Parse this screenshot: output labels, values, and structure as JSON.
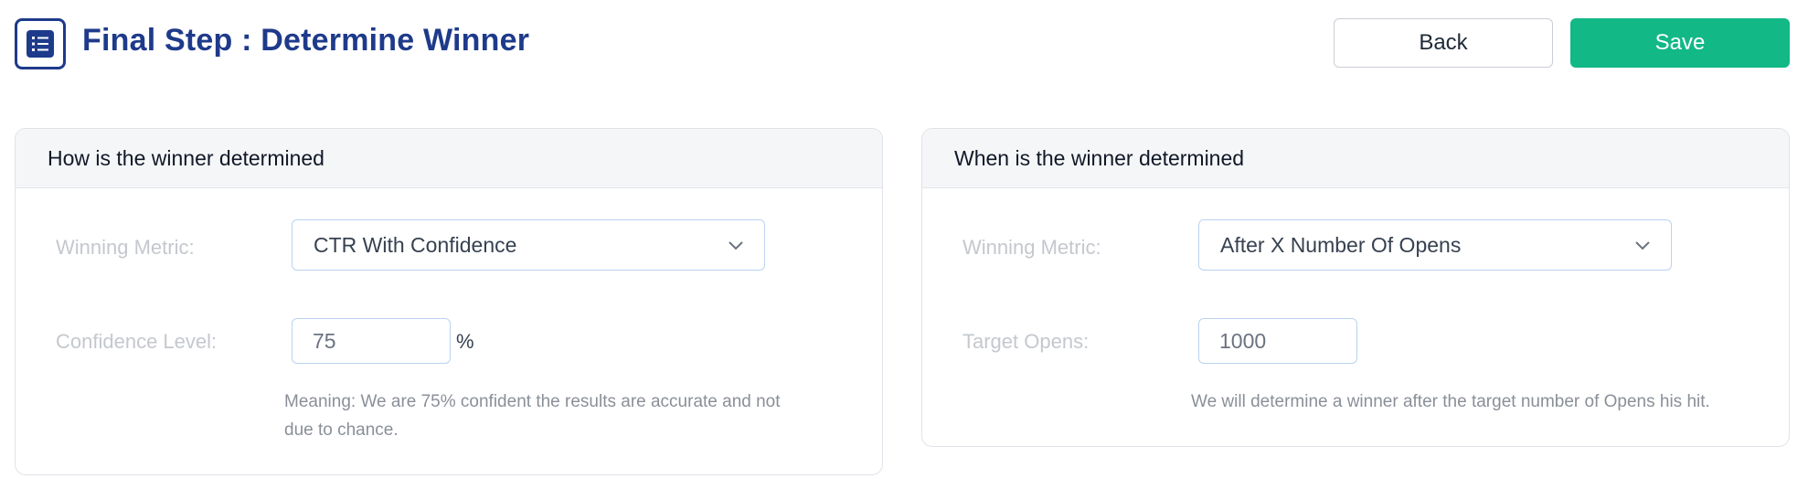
{
  "header": {
    "title": "Final Step : Determine Winner",
    "icon": "checklist-icon",
    "back_label": "Back",
    "save_label": "Save"
  },
  "colors": {
    "brand": "#1e3a8a",
    "save": "#12b886",
    "input_border": "#b9d3f2"
  },
  "left_card": {
    "title": "How is the winner determined",
    "metric_label": "Winning Metric:",
    "metric_value": "CTR With Confidence",
    "confidence_label": "Confidence Level:",
    "confidence_value": "75",
    "confidence_suffix": "%",
    "help_line1": "Meaning: We are 75% confident the results are accurate and not",
    "help_line2": "due to chance."
  },
  "right_card": {
    "title": "When is the winner determined",
    "metric_label": "Winning Metric:",
    "metric_value": "After X Number Of Opens",
    "target_label": "Target Opens:",
    "target_value": "1000",
    "help_line1": "We will determine a winner after the target number of Opens his hit."
  }
}
